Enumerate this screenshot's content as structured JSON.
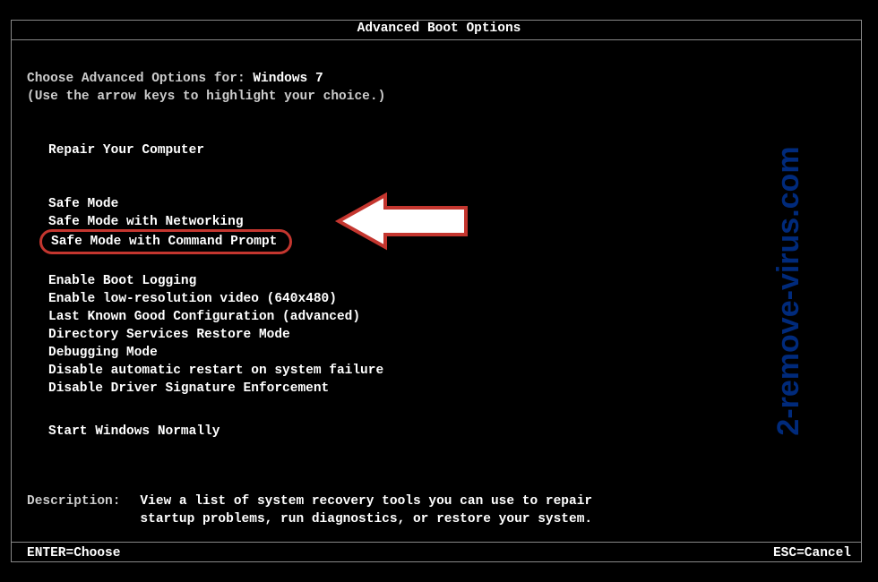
{
  "title": "Advanced Boot Options",
  "choose_prefix": "Choose Advanced Options for: ",
  "os_name": "Windows 7",
  "hint": "(Use the arrow keys to highlight your choice.)",
  "group_repair": {
    "item": "Repair Your Computer"
  },
  "group_safe": {
    "items": [
      "Safe Mode",
      "Safe Mode with Networking",
      "Safe Mode with Command Prompt"
    ]
  },
  "group_misc": {
    "items": [
      "Enable Boot Logging",
      "Enable low-resolution video (640x480)",
      "Last Known Good Configuration (advanced)",
      "Directory Services Restore Mode",
      "Debugging Mode",
      "Disable automatic restart on system failure",
      "Disable Driver Signature Enforcement"
    ]
  },
  "group_normal": {
    "item": "Start Windows Normally"
  },
  "description": {
    "label": "Description:",
    "text": "View a list of system recovery tools you can use to repair startup problems, run diagnostics, or restore your system."
  },
  "footer": {
    "enter": "ENTER=Choose",
    "esc": "ESC=Cancel"
  },
  "watermark": "2-remove-virus.com"
}
